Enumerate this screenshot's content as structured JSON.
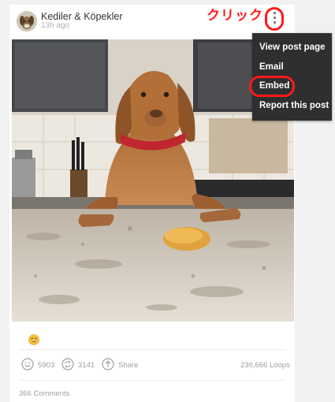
{
  "post": {
    "author": "Kediler & Köpekler",
    "time": "13h ago",
    "emoji": "😀"
  },
  "annotation": {
    "text": "クリック"
  },
  "menu": {
    "items": [
      {
        "label": "View post page"
      },
      {
        "label": "Email"
      },
      {
        "label": "Embed"
      },
      {
        "label": "Report this post"
      }
    ]
  },
  "stats": {
    "likes": "5903",
    "revines": "3141",
    "share_label": "Share",
    "loops": "236,666 Loops",
    "comments": "366 Comments"
  },
  "icons": {
    "more": "vertical-ellipsis-icon",
    "like": "smiley-icon",
    "revine": "repost-icon",
    "share": "share-arrow-icon"
  },
  "colors": {
    "annotation_red": "#ff1a1a",
    "menu_bg": "#2f2f2f",
    "stat_text": "#a0a0a0"
  }
}
